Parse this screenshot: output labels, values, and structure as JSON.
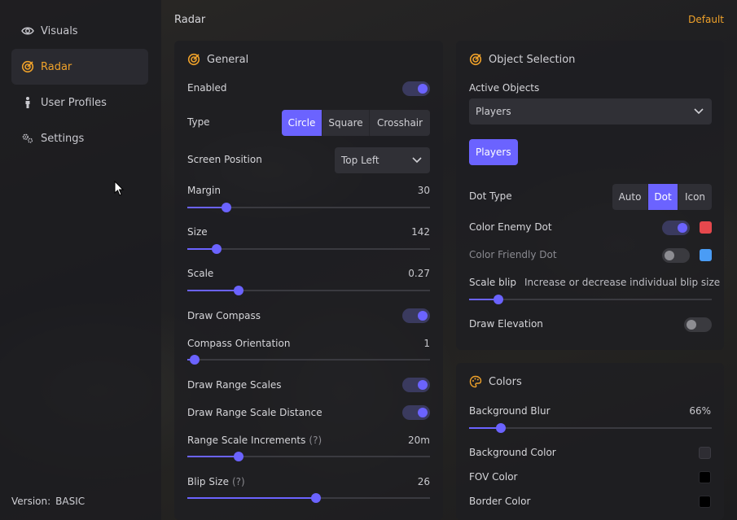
{
  "sidebar": {
    "items": [
      {
        "label": "Visuals",
        "icon": "eye-icon"
      },
      {
        "label": "Radar",
        "icon": "radar-icon"
      },
      {
        "label": "User Profiles",
        "icon": "person-icon"
      },
      {
        "label": "Settings",
        "icon": "gears-icon"
      }
    ],
    "active": "Radar",
    "version_label": "Version:",
    "version_value": "BASIC"
  },
  "header": {
    "title": "Radar",
    "default_label": "Default"
  },
  "colors": {
    "accent": "#6b63ff",
    "brand": "#f0a22a"
  },
  "general": {
    "title": "General",
    "enabled": {
      "label": "Enabled",
      "on": true
    },
    "type": {
      "label": "Type",
      "options": [
        "Circle",
        "Square",
        "Crosshair"
      ],
      "selected": "Circle"
    },
    "screen_position": {
      "label": "Screen Position",
      "value": "Top Left"
    },
    "margin": {
      "label": "Margin",
      "value": "30",
      "fraction": 0.16
    },
    "size": {
      "label": "Size",
      "value": "142",
      "fraction": 0.12
    },
    "scale": {
      "label": "Scale",
      "value": "0.27",
      "fraction": 0.21
    },
    "draw_compass": {
      "label": "Draw Compass",
      "on": true
    },
    "compass_orientation": {
      "label": "Compass Orientation",
      "value": "1",
      "fraction": 0.03
    },
    "draw_range_scales": {
      "label": "Draw Range Scales",
      "on": true
    },
    "draw_range_scale_distance": {
      "label": "Draw Range Scale Distance",
      "on": true
    },
    "range_scale_increments": {
      "label": "Range Scale Increments",
      "help": "(?)",
      "value": "20m",
      "fraction": 0.21
    },
    "blip_size": {
      "label": "Blip Size",
      "help": "(?)",
      "value": "26",
      "fraction": 0.53
    }
  },
  "object_selection": {
    "title": "Object Selection",
    "active_objects": {
      "label": "Active Objects",
      "value": "Players"
    },
    "chip": "Players",
    "dot_type": {
      "label": "Dot Type",
      "options": [
        "Auto",
        "Dot",
        "Icon"
      ],
      "selected": "Dot"
    },
    "color_enemy_dot": {
      "label": "Color Enemy Dot",
      "on": true,
      "color": "#e5484d"
    },
    "color_friendly_dot": {
      "label": "Color Friendly Dot",
      "on": false,
      "color": "#4a9cf5"
    },
    "scale_blip": {
      "label": "Scale blip",
      "hint": "Increase or decrease individual blip size",
      "fraction": 0.12
    },
    "draw_elevation": {
      "label": "Draw Elevation",
      "on": false
    }
  },
  "colors_panel": {
    "title": "Colors",
    "background_blur": {
      "label": "Background Blur",
      "value": "66%",
      "fraction": 0.13
    },
    "background_color": {
      "label": "Background Color",
      "color": "#2e2d33"
    },
    "fov_color": {
      "label": "FOV Color",
      "color": "#000000"
    },
    "border_color": {
      "label": "Border Color",
      "color": "#000000"
    }
  }
}
